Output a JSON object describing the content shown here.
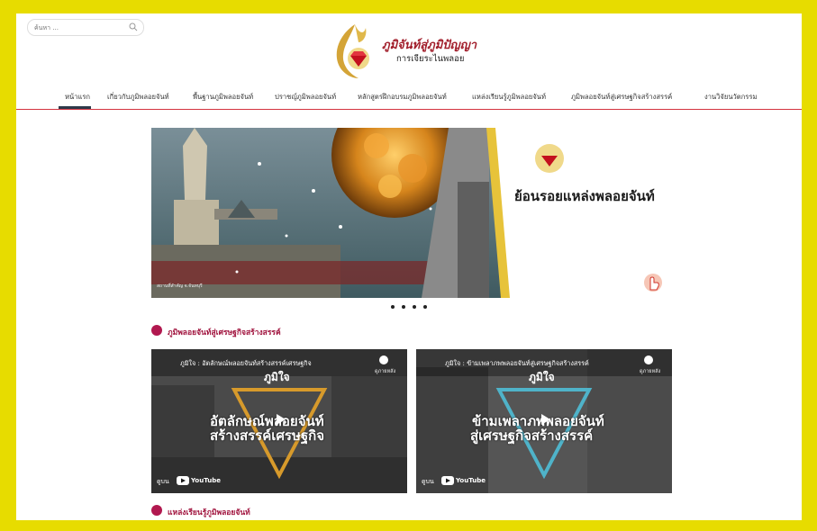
{
  "search": {
    "placeholder": "ค้นหา ..."
  },
  "logo": {
    "title": "ภูมิจันท์สู่ภูมิปัญญา",
    "subtitle": "การเจียระไนพลอย"
  },
  "nav": {
    "items": [
      "หน้าแรก",
      "เกี่ยวกับภูมิพลอยจันท์",
      "พื้นฐานภูมิพลอยจันท์",
      "ปราชญ์ภูมิพลอยจันท์",
      "หลักสูตรฝึกอบรมภูมิพลอยจันท์",
      "แหล่งเรียนรู้ภูมิพลอยจันท์",
      "ภูมิพลอยจันท์สู่เศรษฐกิจสร้างสรรค์",
      "งานวิจัยนวัตกรรม"
    ],
    "active_index": 0
  },
  "banner": {
    "headline": "ย้อนรอยแหล่งพลอยจันท์",
    "caption": "สถานที่สำคัญ จ.จันทบุรี",
    "slide_count": 4,
    "active_slide": 0
  },
  "sections": {
    "creative": "ภูมิพลอยจันท์สู่เศรษฐกิจสร้างสรรค์",
    "learning": "แหล่งเรียนรู้ภูมิพลอยจันท์"
  },
  "videos": [
    {
      "title": "ภูมิใจ : อัตลักษณ์พลอยจันท์สร้างสรรค์เศรษฐกิจ",
      "brand": "ภูมิใจ",
      "line1": "อัตลักษณ์พลอยจันท์",
      "line2": "สร้างสรรค์เศรษฐกิจ",
      "watch_later": "ดูภายหลัง",
      "watch_on": "ดูบน",
      "platform": "YouTube",
      "accent": "#d79a2b"
    },
    {
      "title": "ภูมิใจ : ข้ามเพลาภพพลอยจันท์สู่เศรษฐกิจสร้างสรรค์",
      "brand": "ภูมิใจ",
      "line1": "ข้ามเพลาภพพลอยจันท์",
      "line2": "สู่เศรษฐกิจสร้างสรรค์",
      "watch_later": "ดูภายหลัง",
      "watch_on": "ดูบน",
      "platform": "YouTube",
      "accent": "#4fb3c9"
    }
  ],
  "colors": {
    "frame": "#e7dc00",
    "accent": "#a0123d",
    "nav_line": "#d4333f"
  }
}
